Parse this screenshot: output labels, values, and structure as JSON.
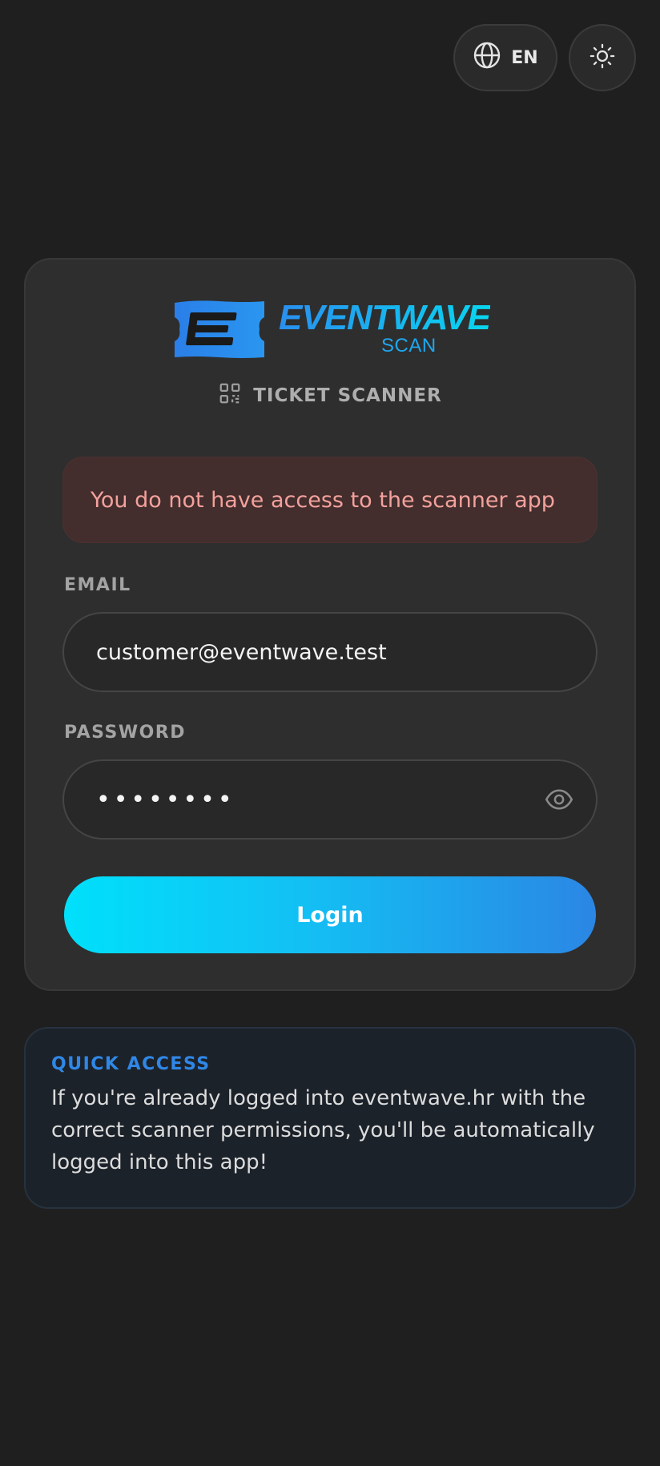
{
  "header": {
    "language_label": "EN"
  },
  "logo": {
    "title": "EVENTWAVE",
    "subtitle": "SCAN"
  },
  "login": {
    "scanner_title": "TICKET SCANNER",
    "error_message": "You do not have access to the scanner app",
    "email_label": "EMAIL",
    "email_value": "customer@eventwave.test",
    "password_label": "PASSWORD",
    "password_value": "••••••••",
    "login_button": "Login"
  },
  "quick_access": {
    "title": "QUICK ACCESS",
    "text": "If you're already logged into eventwave.hr with the correct scanner permissions, you'll be automatically logged into this app!"
  },
  "colors": {
    "background": "#1f1f1f",
    "card": "#2e2e2e",
    "error_bg": "#432d2d",
    "error_text": "#f3a19c",
    "accent_start": "#00e0fb",
    "accent_end": "#2b86e4",
    "quick_title": "#2f87e6"
  },
  "icons": {
    "language": "globe-icon",
    "theme": "sun-icon",
    "scanner": "qr-code-icon",
    "password_toggle": "eye-icon",
    "logo": "ticket-logo-icon"
  }
}
